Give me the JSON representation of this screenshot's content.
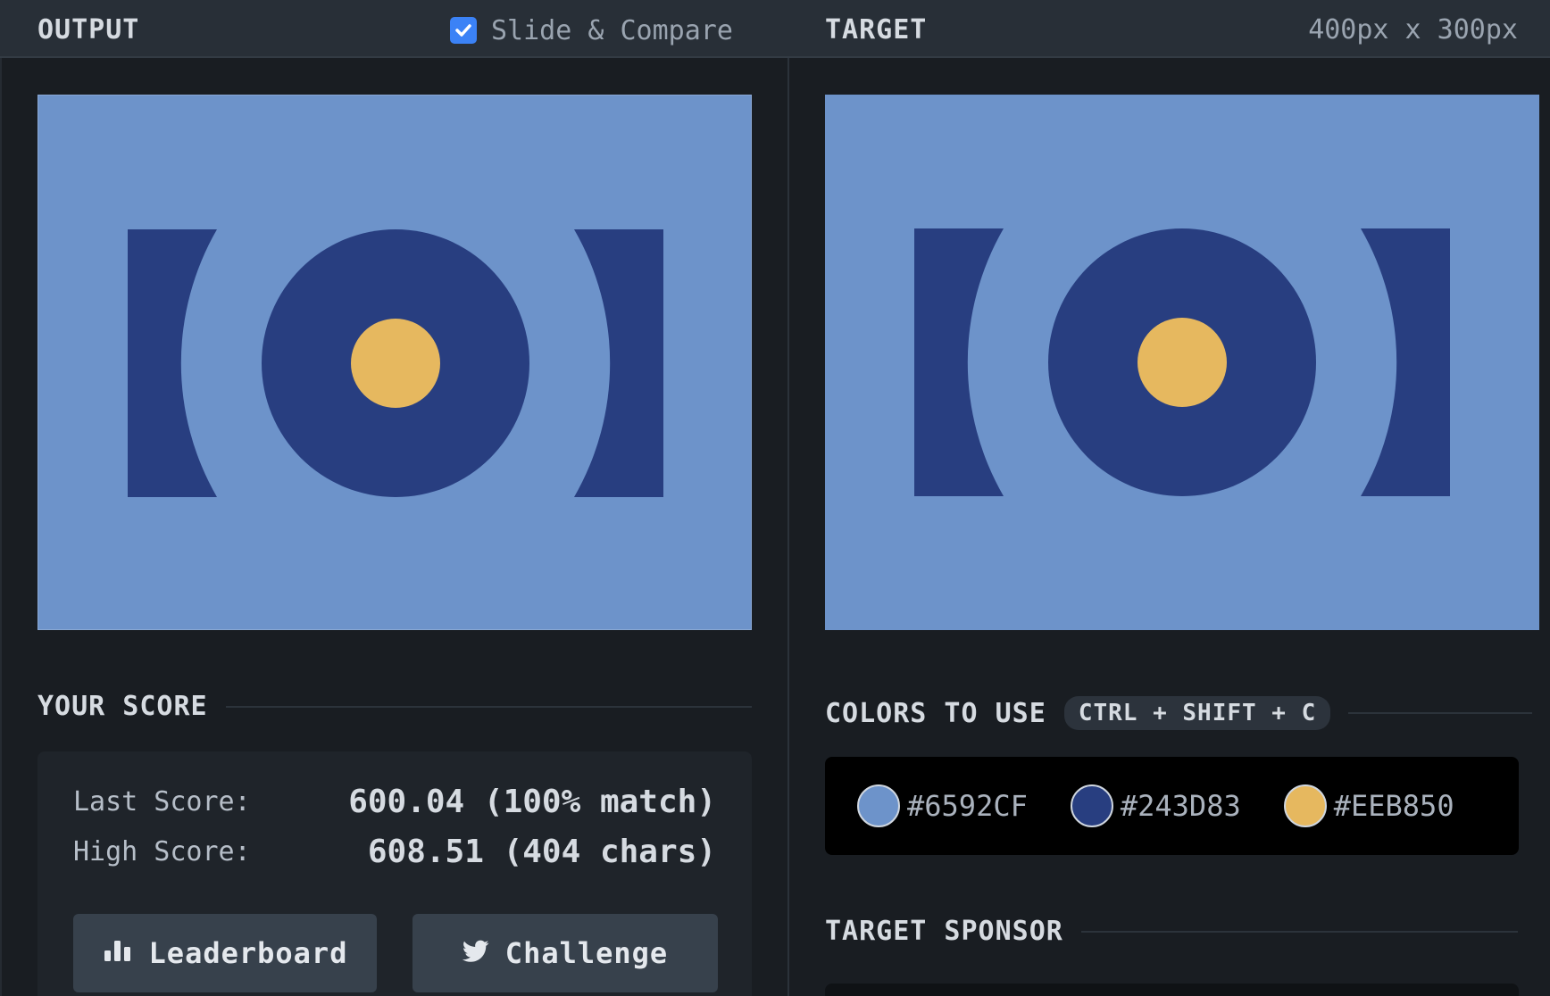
{
  "header": {
    "output_title": "OUTPUT",
    "compare_label": "Slide & Compare",
    "compare_checked": true,
    "target_title": "TARGET",
    "dimensions": "400px x 300px"
  },
  "score": {
    "title": "YOUR SCORE",
    "last_label": "Last Score:",
    "last_value": "600.04 (100% match)",
    "high_label": "High Score:",
    "high_value": "608.51 (404 chars)",
    "leaderboard_label": "Leaderboard",
    "challenge_label": "Challenge"
  },
  "colors": {
    "title": "COLORS TO USE",
    "shortcut": "CTRL + SHIFT + C",
    "swatches": [
      {
        "hex": "#6592CF"
      },
      {
        "hex": "#243D83"
      },
      {
        "hex": "#EEB850"
      }
    ]
  },
  "sponsor": {
    "title": "TARGET SPONSOR"
  },
  "theme": {
    "background": "#6d93ca",
    "shape": "#283e80",
    "accent": "#e6b85f",
    "button_bg": "#37414c",
    "checkbox": "#3b82f6"
  }
}
